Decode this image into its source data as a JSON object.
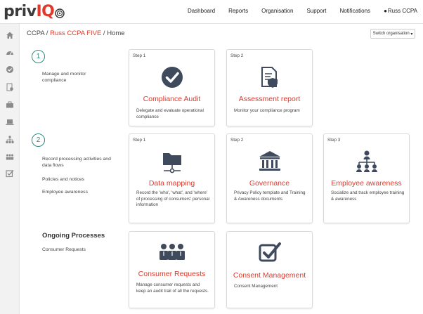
{
  "header": {
    "logo_main": "priv",
    "logo_accent": "IQ",
    "nav": [
      "Dashboard",
      "Reports",
      "Organisation",
      "Support",
      "Notifications"
    ],
    "user": "Russ CCPA"
  },
  "breadcrumb": {
    "root": "CCPA",
    "sep1": " / ",
    "org": "Russ CCPA FIVE",
    "sep2": " / ",
    "page": "Home"
  },
  "switch_label": "Switch organisation",
  "sidebar_icons": [
    "home-icon",
    "dashboard-gauge-icon",
    "check-circle-icon",
    "document-settings-icon",
    "briefcase-icon",
    "laptop-icon",
    "org-chart-icon",
    "users-group-icon",
    "checkbox-icon"
  ],
  "section1": {
    "number": "1",
    "text": "Manage and monitor compliance",
    "cards": [
      {
        "step": "Step 1",
        "title": "Compliance Audit",
        "desc": "Delegate and evaluate operational compliance",
        "icon": "check-badge-icon"
      },
      {
        "step": "Step 2",
        "title": "Assessment report",
        "desc": "Monitor your compliance program",
        "icon": "report-shield-icon"
      }
    ]
  },
  "section2": {
    "number": "2",
    "items": [
      "Record processing activities and data flows",
      "Policies and notices",
      "Employee awareness"
    ],
    "cards": [
      {
        "step": "Step 1",
        "title": "Data mapping",
        "desc": "Record the 'who', 'what', and 'where' of processing of consumers' personal information",
        "icon": "folder-network-icon"
      },
      {
        "step": "Step 2",
        "title": "Governance",
        "desc": "Privacy Policy template and Training & Awareness documents",
        "icon": "bank-building-icon"
      },
      {
        "step": "Step 3",
        "title": "Employee awareness",
        "desc": "Socialize and track employee training & awareness",
        "icon": "org-hierarchy-icon"
      }
    ]
  },
  "ongoing": {
    "title": "Ongoing Processes",
    "item": "Consumer Requests",
    "cards": [
      {
        "title": "Consumer Requests",
        "desc": "Manage consumer requests and keep an audit trail of all the requests.",
        "icon": "people-group-icon"
      },
      {
        "title": "Consent Management",
        "desc": "Consent Management",
        "icon": "checked-box-icon"
      }
    ]
  },
  "colors": {
    "accent": "#e0392b",
    "teal": "#2f8a7e",
    "icon": "#3f4a5c"
  }
}
